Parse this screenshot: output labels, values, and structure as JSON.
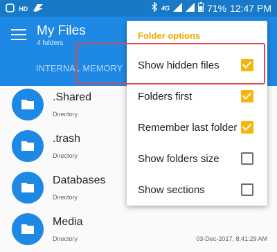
{
  "status_bar": {
    "carrier_badge": "HD",
    "network_label": "4G",
    "battery": "71%",
    "time": "12:47 PM"
  },
  "app_bar": {
    "title": "My Files",
    "subtitle": "4 folders",
    "tab": "INTERNAL MEMORY",
    "accent_color": "#1e88e5"
  },
  "files": [
    {
      "name": ".Shared",
      "type": "Directory",
      "date": ""
    },
    {
      "name": ".trash",
      "type": "Directory",
      "date": ""
    },
    {
      "name": "Databases",
      "type": "Directory",
      "date": ""
    },
    {
      "name": "Media",
      "type": "Directory",
      "date": "03-Dec-2017, 8:41:29 AM"
    }
  ],
  "folder_options": {
    "title": "Folder options",
    "accent_color": "#f5b50a",
    "items": [
      {
        "label": "Show hidden files",
        "checked": true
      },
      {
        "label": "Folders first",
        "checked": true
      },
      {
        "label": "Remember last folder",
        "checked": true
      },
      {
        "label": "Show folders size",
        "checked": false
      },
      {
        "label": "Show sections",
        "checked": false
      }
    ]
  },
  "icons": [
    "menu-icon",
    "folder-icon",
    "bluetooth-icon",
    "signal-icon",
    "battery-icon",
    "app-logo-icon"
  ]
}
